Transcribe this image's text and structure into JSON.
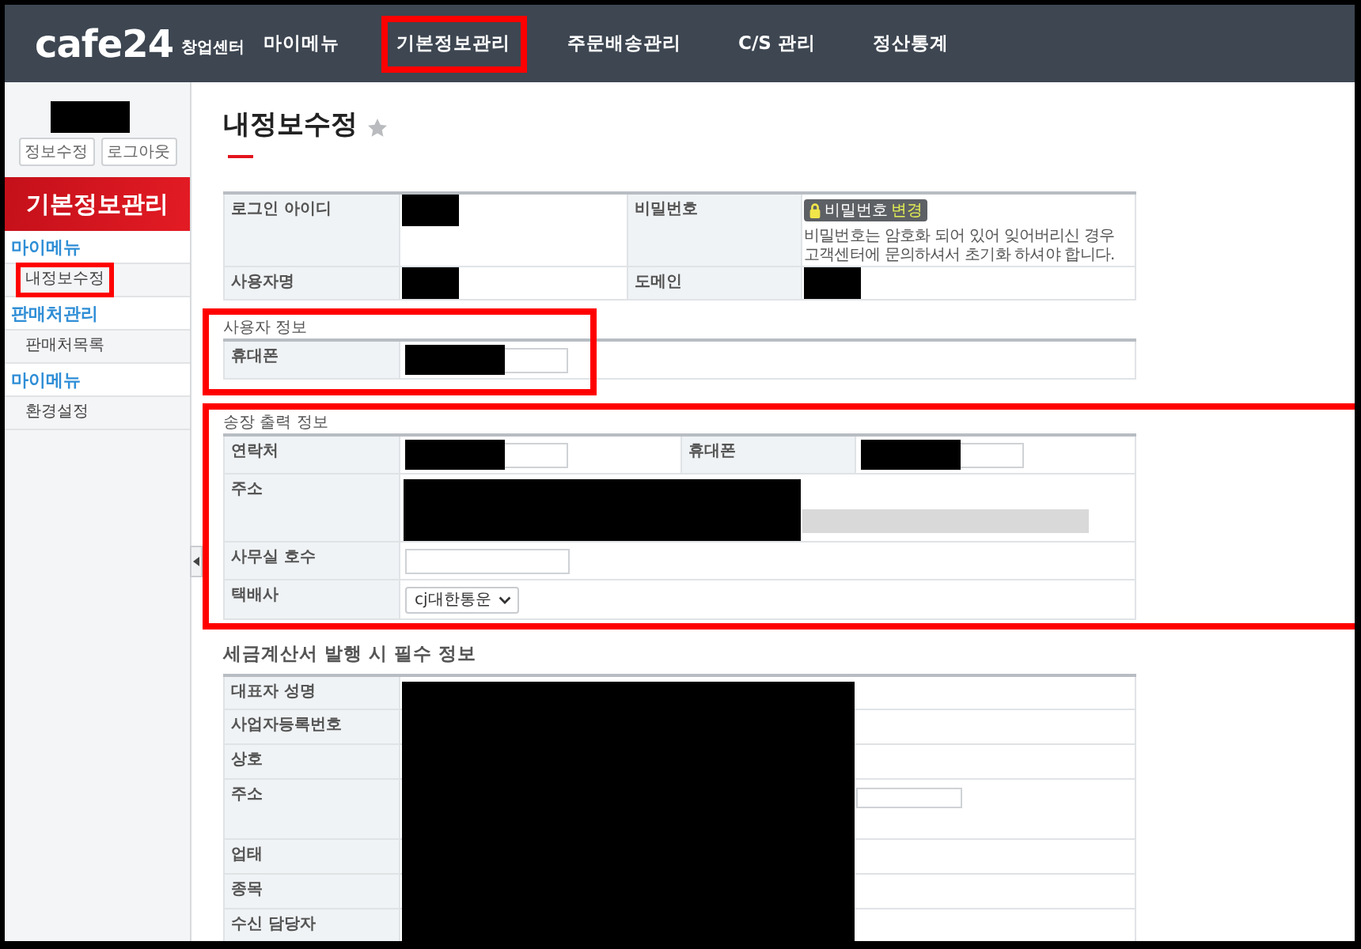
{
  "nav": {
    "logo": "cafe24",
    "logo_caption": "창업센터",
    "items": [
      {
        "label": "마이메뉴",
        "highlighted": false
      },
      {
        "label": "기본정보관리",
        "highlighted": true
      },
      {
        "label": "주문배송관리",
        "highlighted": false
      },
      {
        "label": "C/S 관리",
        "highlighted": false
      },
      {
        "label": "정산통계",
        "highlighted": false
      }
    ]
  },
  "sidebar": {
    "user_redacted": true,
    "buttons": [
      "정보수정",
      "로그아웃"
    ],
    "title": "기본정보관리",
    "groups": [
      {
        "title": "마이메뉴",
        "items": [
          {
            "label": "내정보수정",
            "highlighted": true
          }
        ]
      },
      {
        "title": "판매처관리",
        "items": [
          {
            "label": "판매처목록",
            "highlighted": false
          }
        ]
      },
      {
        "title": "마이메뉴",
        "items": [
          {
            "label": "환경설정",
            "highlighted": false
          }
        ]
      }
    ]
  },
  "page": {
    "title": "내정보수정",
    "starred": false
  },
  "account": {
    "rows": [
      [
        {
          "label": "로그인 아이디",
          "kind": "text",
          "redacted": true
        },
        {
          "label": "비밀번호",
          "kind": "password",
          "button": "비밀번호",
          "button_accent": "변경",
          "note": "비밀번호는 암호화 되어 있어 잊어버리신 경우 고객센터에 문의하셔서 초기화 하셔야 합니다."
        }
      ],
      [
        {
          "label": "사용자명",
          "kind": "text",
          "redacted": true
        },
        {
          "label": "도메인",
          "kind": "text",
          "redacted": true
        }
      ]
    ]
  },
  "sections": [
    {
      "title": "사용자 정보",
      "highlighted": true,
      "rows": [
        [
          {
            "label": "휴대폰",
            "kind": "input",
            "redacted": true
          }
        ]
      ]
    },
    {
      "title": "송장 출력 정보",
      "highlighted": true,
      "rows": [
        [
          {
            "label": "연락처",
            "kind": "input",
            "redacted": true
          },
          {
            "label": "휴대폰",
            "kind": "input",
            "redacted": true
          }
        ],
        [
          {
            "label": "주소",
            "kind": "address",
            "redacted": true,
            "detail_disabled": true
          }
        ],
        [
          {
            "label": "사무실 호수",
            "kind": "input",
            "redacted": false
          }
        ],
        [
          {
            "label": "택배사",
            "kind": "select",
            "value": "cj대한통운"
          }
        ]
      ]
    }
  ],
  "tax_info": {
    "title": "세금계산서 발행 시 필수 정보",
    "values_redacted": true,
    "rows": [
      {
        "label": "대표자 성명",
        "kind": "text"
      },
      {
        "label": "사업자등록번호",
        "kind": "text"
      },
      {
        "label": "상호",
        "kind": "text"
      },
      {
        "label": "주소",
        "kind": "input"
      },
      {
        "label": "업태",
        "kind": "text"
      },
      {
        "label": "종목",
        "kind": "text"
      },
      {
        "label": "수신 담당자",
        "kind": "text"
      }
    ]
  }
}
